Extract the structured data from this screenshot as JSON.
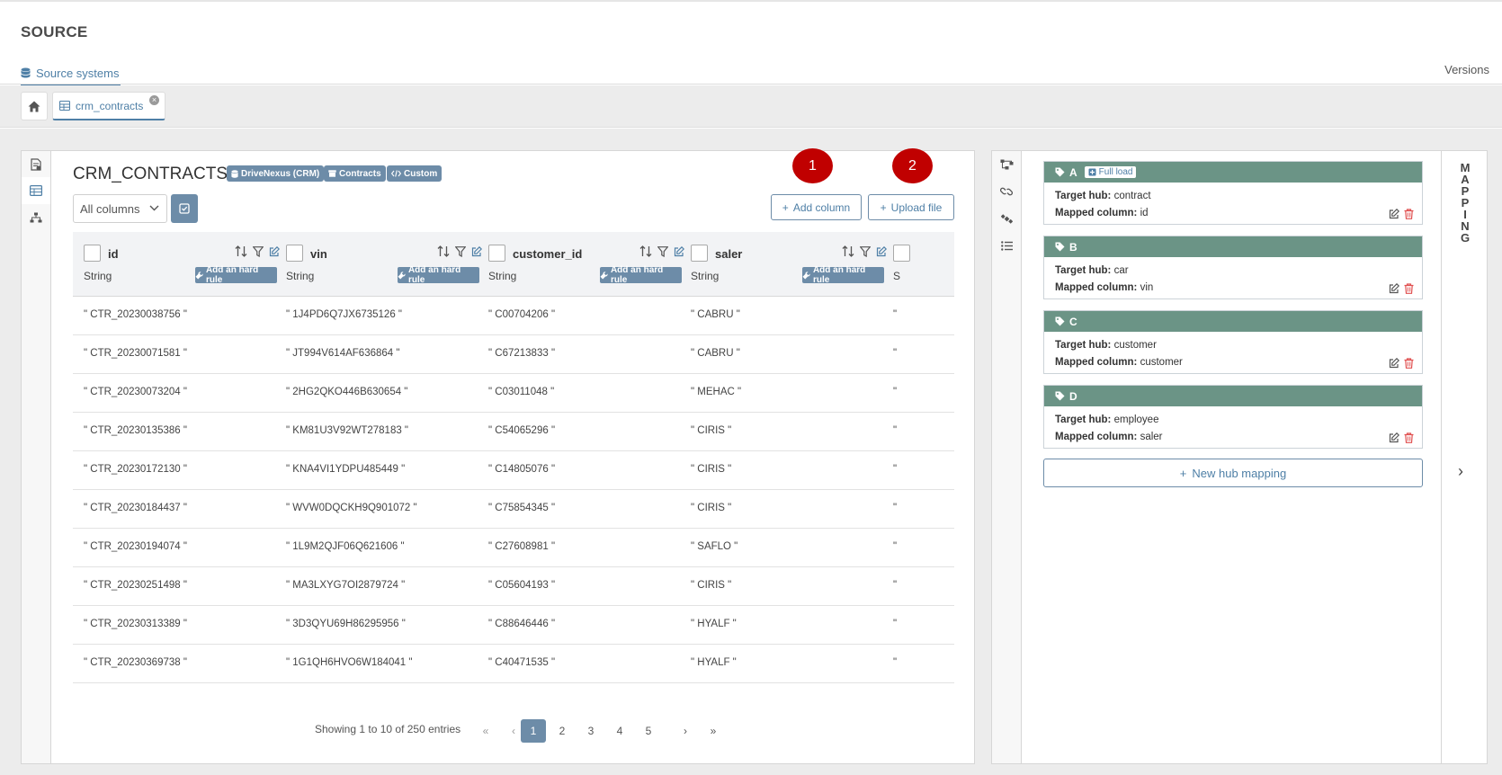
{
  "header": {
    "title": "SOURCE",
    "source_tab_label": "Source systems",
    "versions_label": "Versions"
  },
  "tabs": {
    "open_tab_label": "crm_contracts",
    "close_glyph": "×"
  },
  "table_view": {
    "title": "CRM_CONTRACTS",
    "badges": [
      "DriveNexus (CRM)",
      "Contracts",
      "Custom"
    ],
    "column_filter_value": "All columns",
    "add_column_label": "Add column",
    "upload_file_label": "Upload file",
    "callouts": [
      "1",
      "2"
    ],
    "columns": [
      {
        "name": "id",
        "type": "String",
        "rule_label": "Add an hard rule"
      },
      {
        "name": "vin",
        "type": "String",
        "rule_label": "Add an hard rule"
      },
      {
        "name": "customer_id",
        "type": "String",
        "rule_label": "Add an hard rule"
      },
      {
        "name": "saler",
        "type": "String",
        "rule_label": "Add an hard rule"
      }
    ],
    "partial_column_type": "S",
    "rows": [
      [
        "\" CTR_20230038756 \"",
        "\" 1J4PD6Q7JX6735126 \"",
        "\" C00704206 \"",
        "\" CABRU \""
      ],
      [
        "\" CTR_20230071581 \"",
        "\" JT994V614AF636864 \"",
        "\" C67213833 \"",
        "\" CABRU \""
      ],
      [
        "\" CTR_20230073204 \"",
        "\" 2HG2QKO446B630654 \"",
        "\" C03011048 \"",
        "\" MEHAC \""
      ],
      [
        "\" CTR_20230135386 \"",
        "\" KM81U3V92WT278183 \"",
        "\" C54065296 \"",
        "\" CIRIS \""
      ],
      [
        "\" CTR_20230172130 \"",
        "\" KNA4VI1YDPU485449 \"",
        "\" C14805076 \"",
        "\" CIRIS \""
      ],
      [
        "\" CTR_20230184437 \"",
        "\" WVW0DQCKH9Q901072 \"",
        "\" C75854345 \"",
        "\" CIRIS \""
      ],
      [
        "\" CTR_20230194074 \"",
        "\" 1L9M2QJF06Q621606 \"",
        "\" C27608981 \"",
        "\" SAFLO \""
      ],
      [
        "\" CTR_20230251498 \"",
        "\" MA3LXYG7OI2879724 \"",
        "\" C05604193 \"",
        "\" CIRIS \""
      ],
      [
        "\" CTR_20230313389 \"",
        "\" 3D3QYU69H86295956 \"",
        "\" C88646446 \"",
        "\" HYALF \""
      ],
      [
        "\" CTR_20230369738 \"",
        "\" 1G1QH6HVO6W184041 \"",
        "\" C40471535 \"",
        "\" HYALF \""
      ]
    ],
    "partial_cell": "\"",
    "pagination": {
      "summary": "Showing 1 to 10 of 250 entries",
      "first": "«",
      "prev": "‹",
      "pages": [
        "1",
        "2",
        "3",
        "4",
        "5"
      ],
      "next": "›",
      "last": "»",
      "current": "1"
    }
  },
  "mapping": {
    "side_label": [
      "M",
      "A",
      "P",
      "P",
      "I",
      "N",
      "G"
    ],
    "expand_glyph": "›",
    "full_load_label": "Full load",
    "target_hub_label": "Target hub:",
    "mapped_column_label": "Mapped column:",
    "hubs": [
      {
        "letter": "A",
        "target_hub": "contract",
        "mapped_column": "id"
      },
      {
        "letter": "B",
        "target_hub": "car",
        "mapped_column": "vin"
      },
      {
        "letter": "C",
        "target_hub": "customer",
        "mapped_column": "customer"
      },
      {
        "letter": "D",
        "target_hub": "employee",
        "mapped_column": "saler"
      }
    ],
    "new_hub_label": "New hub mapping"
  },
  "colors": {
    "accent": "#4e7fa6",
    "badge": "#6d8ca8",
    "hub_header": "#6b9486",
    "callout": "#c00000",
    "delete": "#e05050"
  }
}
